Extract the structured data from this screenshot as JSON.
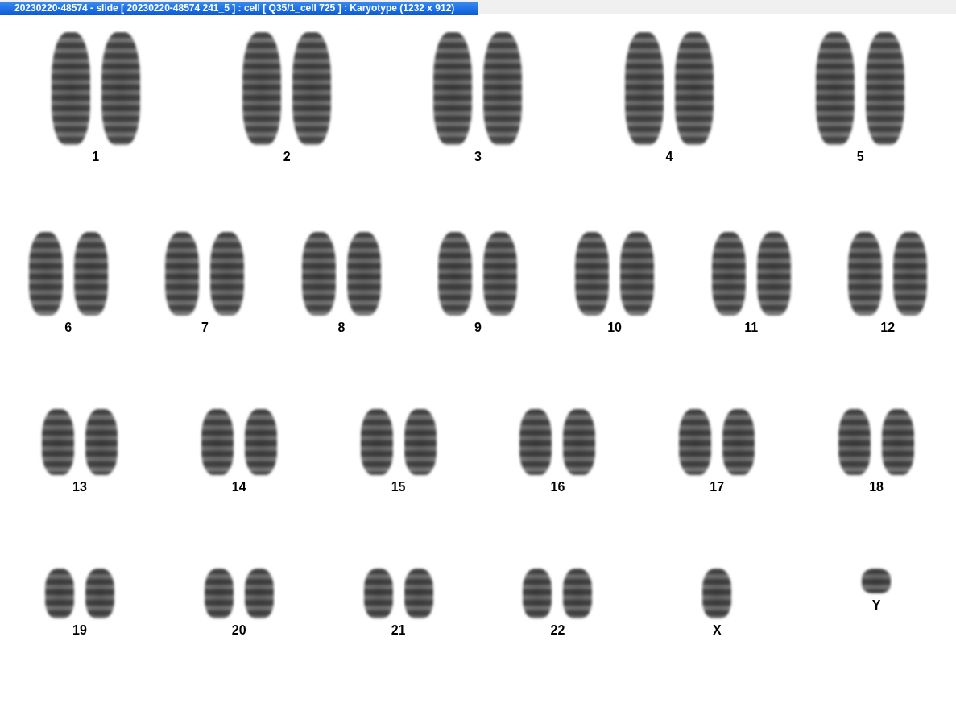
{
  "window": {
    "title": "20230220-48574 - slide [ 20230220-48574 241_5 ] : cell [ Q35/1_cell 725 ] : Karyotype  (1232 x 912)"
  },
  "rows": [
    {
      "pairs": [
        {
          "label": "1",
          "kind": "pair"
        },
        {
          "label": "2",
          "kind": "pair"
        },
        {
          "label": "3",
          "kind": "pair"
        },
        {
          "label": "4",
          "kind": "pair"
        },
        {
          "label": "5",
          "kind": "pair"
        }
      ]
    },
    {
      "pairs": [
        {
          "label": "6",
          "kind": "pair"
        },
        {
          "label": "7",
          "kind": "pair"
        },
        {
          "label": "8",
          "kind": "pair"
        },
        {
          "label": "9",
          "kind": "pair"
        },
        {
          "label": "10",
          "kind": "pair"
        },
        {
          "label": "11",
          "kind": "pair"
        },
        {
          "label": "12",
          "kind": "pair"
        }
      ]
    },
    {
      "pairs": [
        {
          "label": "13",
          "kind": "pair"
        },
        {
          "label": "14",
          "kind": "pair"
        },
        {
          "label": "15",
          "kind": "pair"
        },
        {
          "label": "16",
          "kind": "pair"
        },
        {
          "label": "17",
          "kind": "pair"
        },
        {
          "label": "18",
          "kind": "pair"
        }
      ]
    },
    {
      "pairs": [
        {
          "label": "19",
          "kind": "pair"
        },
        {
          "label": "20",
          "kind": "pair"
        },
        {
          "label": "21",
          "kind": "pair"
        },
        {
          "label": "22",
          "kind": "pair"
        },
        {
          "label": "X",
          "kind": "single"
        },
        {
          "label": "Y",
          "kind": "single"
        }
      ]
    }
  ]
}
